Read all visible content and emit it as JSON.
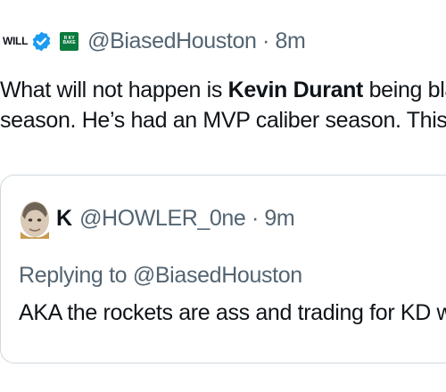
{
  "tweet": {
    "author_name": "WILL",
    "affiliate_badge_text": [
      "R KY",
      "BAKE"
    ],
    "handle": "@BiasedHouston",
    "separator": "·",
    "time": "8m",
    "text_line1_before": "What will not happen is ",
    "text_line1_bold": "Kevin Durant",
    "text_line1_after": " being bla",
    "text_line2": "season. He’s had an MVP caliber season. This r"
  },
  "quote": {
    "author_name": "K",
    "handle": "@HOWLER_0ne",
    "separator": "·",
    "time": "9m",
    "replying_prefix": "Replying to ",
    "replying_handle": "@BiasedHouston",
    "text": "AKA the rockets are ass and trading for KD w"
  },
  "colors": {
    "text": "#0f1419",
    "secondary": "#536471",
    "verified": "#1d9bf0",
    "border": "#cfd9de",
    "affiliate": "#0b7a3e"
  },
  "icons": {
    "verified": "verified-badge-icon",
    "affiliate": "affiliate-badge-icon"
  }
}
